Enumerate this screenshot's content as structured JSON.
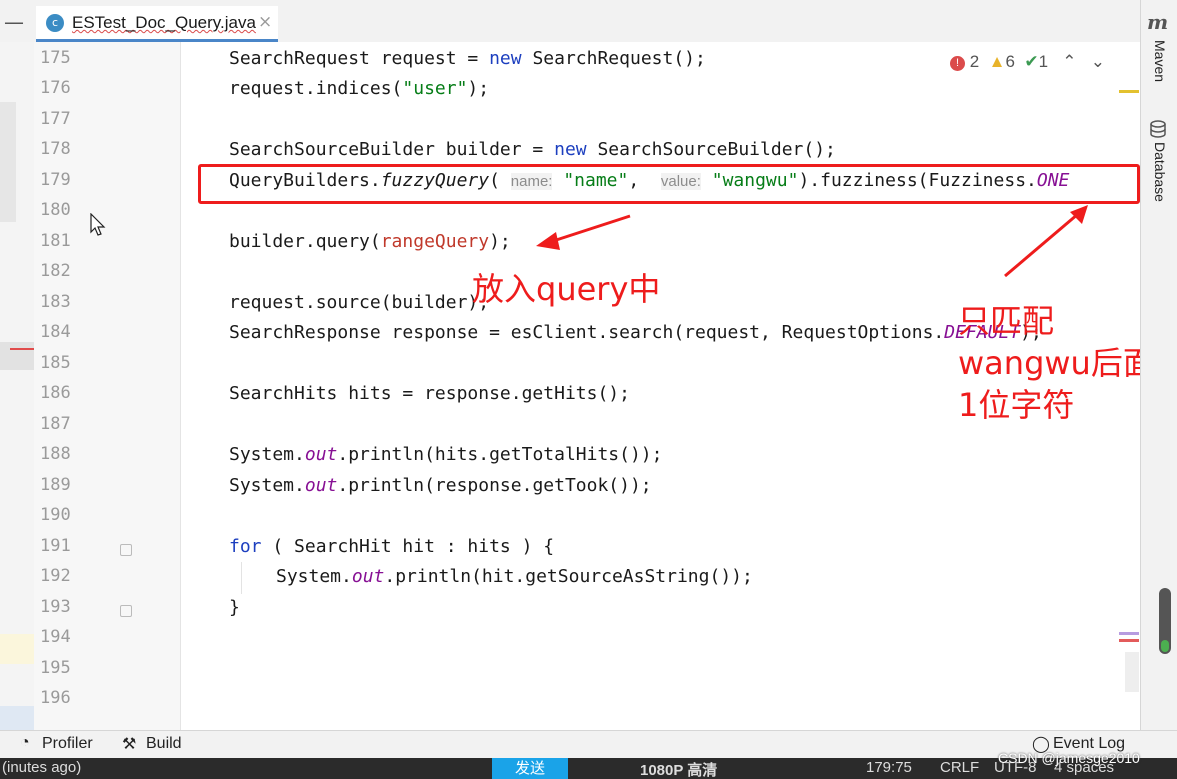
{
  "tab": {
    "title": "ESTest_Doc_Query.java",
    "close": "×",
    "icon_letter": "c"
  },
  "left_dash": "—",
  "gutter": {
    "lines": [
      "175",
      "176",
      "177",
      "178",
      "179",
      "180",
      "181",
      "182",
      "183",
      "184",
      "185",
      "186",
      "187",
      "188",
      "189",
      "190",
      "191",
      "192",
      "193",
      "194",
      "195",
      "196"
    ]
  },
  "inspections": {
    "errors": "2",
    "warnings": "6",
    "weak_warnings": "1"
  },
  "code": {
    "l175": {
      "a": "SearchRequest request = ",
      "b": "new",
      "c": " SearchRequest();"
    },
    "l176": {
      "a": "request.indices(",
      "b": "\"user\"",
      "c": ");"
    },
    "l178": {
      "a": "SearchSourceBuilder builder = ",
      "b": "new",
      "c": " SearchSourceBuilder();"
    },
    "l179": {
      "a": "QueryBuilders.",
      "b": "fuzzyQuery",
      "c": "( ",
      "hint1": "name:",
      "d": "\"name\"",
      "e": ",  ",
      "hint2": "value:",
      "f": "\"wangwu\"",
      "g": ").fuzziness(Fuzziness.",
      "h": "ONE"
    },
    "l181": {
      "a": "builder.query(",
      "b": "rangeQuery",
      "c": ");"
    },
    "l183": "request.source(builder);",
    "l184": {
      "a": "SearchResponse response = esClient.search(request, RequestOptions.",
      "b": "DEFAULT",
      "c": ");"
    },
    "l186": "SearchHits hits = response.getHits();",
    "l188": {
      "a": "System.",
      "b": "out",
      "c": ".println(hits.getTotalHits());"
    },
    "l189": {
      "a": "System.",
      "b": "out",
      "c": ".println(response.getTook());"
    },
    "l191": {
      "a": "for",
      "b": " ( SearchHit hit : hits ) {"
    },
    "l192": {
      "a": "System.",
      "b": "out",
      "c": ".println(hit.getSourceAsString());"
    },
    "l193": "}"
  },
  "annotations": {
    "put_in_query": "放入query中",
    "match_only_line1": "只匹配",
    "match_only_line2": "wangwu后面",
    "match_only_line3": "1位字符"
  },
  "right_panel": {
    "logo": "m",
    "maven": "Maven",
    "database": "Database"
  },
  "bottom": {
    "profiler": "Profiler",
    "build": "Build",
    "event_log": "Event Log"
  },
  "status": {
    "left": "(inutes ago)",
    "send": "发送",
    "quality": "1080P 高清",
    "position": "179:75",
    "line_sep": "CRLF",
    "encoding": "UTF-8",
    "indent": "4 spaces",
    "watermark": "CSDN @jamesge2010"
  }
}
